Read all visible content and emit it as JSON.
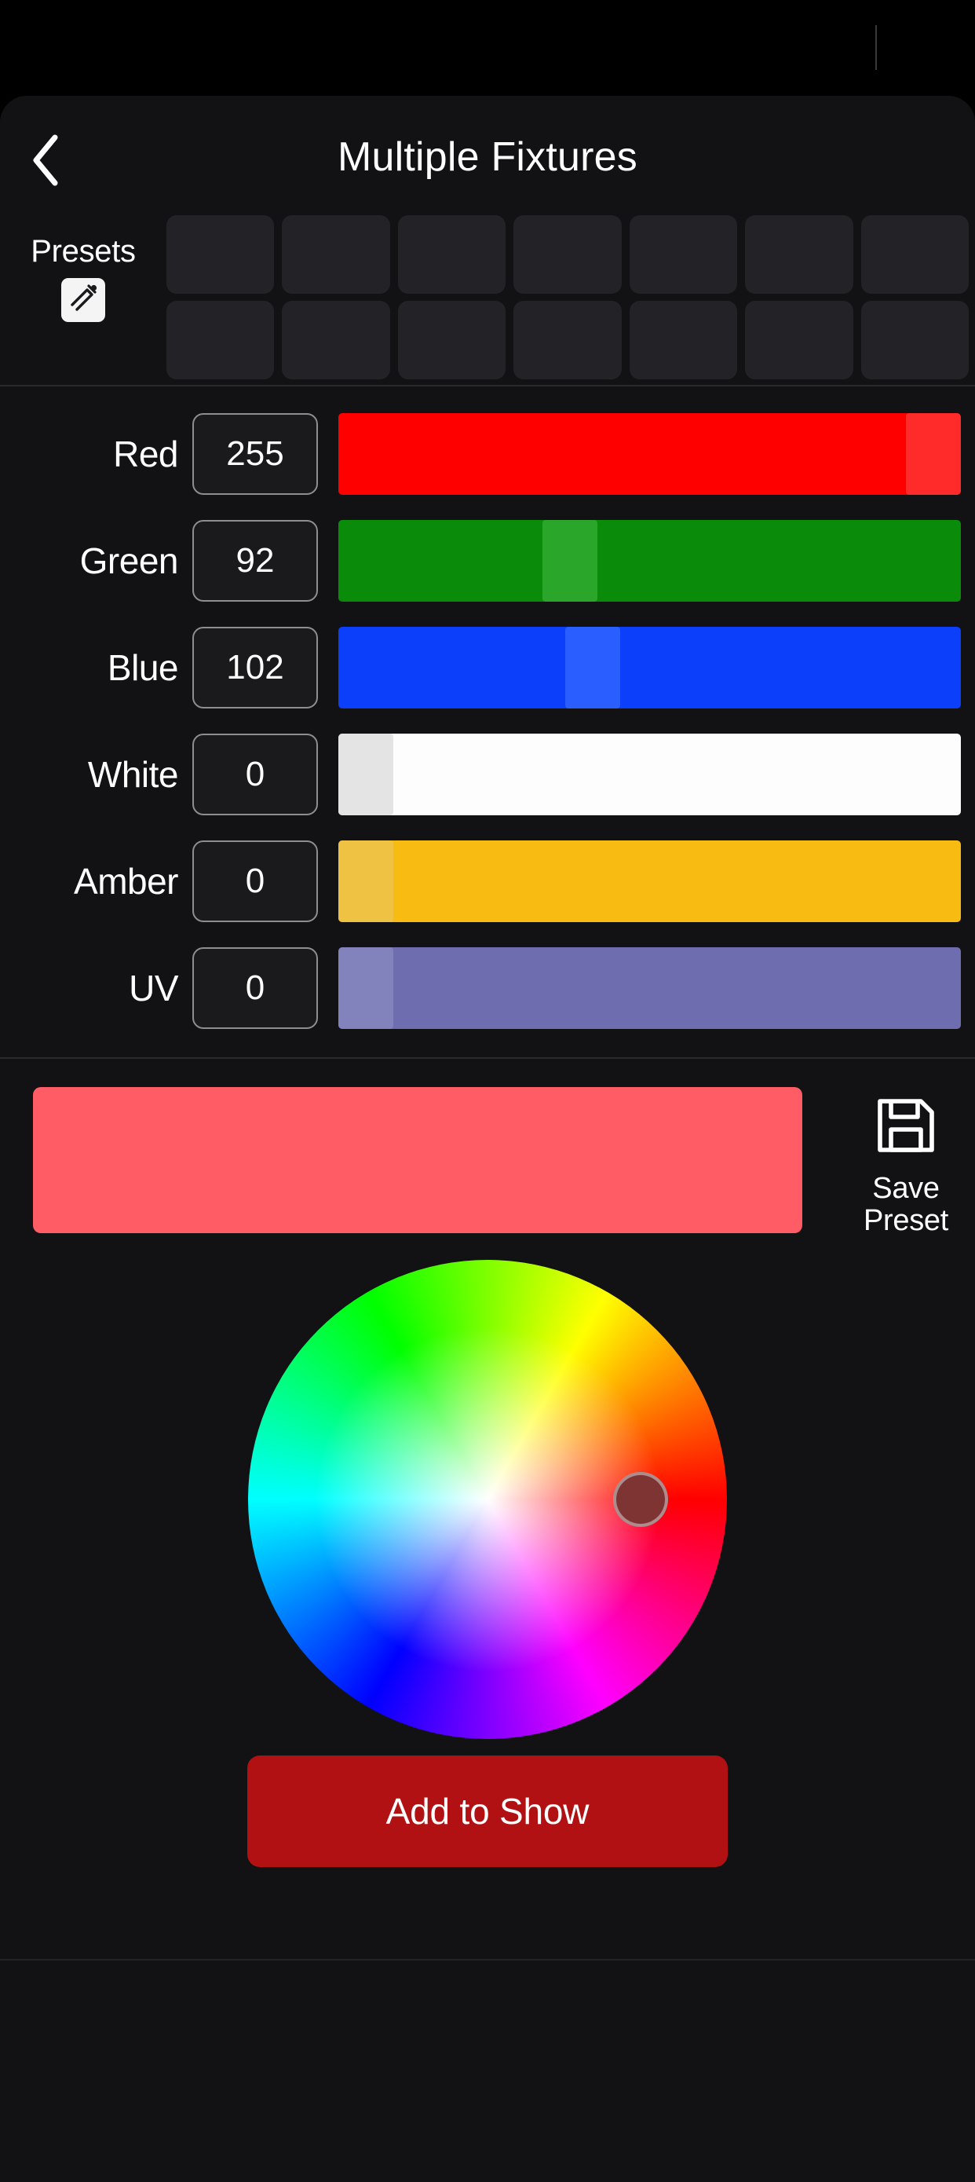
{
  "status_bar": {
    "caret_icon": "text-cursor"
  },
  "header": {
    "title": "Multiple Fixtures",
    "back_icon": "chevron-left-icon"
  },
  "presets": {
    "label": "Presets",
    "edit_icon": "edit-pencil-square-icon",
    "columns": 7,
    "rows": 2,
    "tiles": [
      {
        "label": ""
      },
      {
        "label": ""
      },
      {
        "label": ""
      },
      {
        "label": ""
      },
      {
        "label": ""
      },
      {
        "label": ""
      },
      {
        "label": ""
      },
      {
        "label": ""
      },
      {
        "label": ""
      },
      {
        "label": ""
      },
      {
        "label": ""
      },
      {
        "label": ""
      },
      {
        "label": ""
      },
      {
        "label": ""
      }
    ]
  },
  "channels": [
    {
      "name": "Red",
      "value": "255",
      "percent": 100,
      "track_color": "#fe0000",
      "thumb_color": "#ff2a2a"
    },
    {
      "name": "Green",
      "value": "92",
      "percent": 36,
      "track_color": "#0a8b0a",
      "thumb_color": "#2aa72a"
    },
    {
      "name": "Blue",
      "value": "102",
      "percent": 40,
      "track_color": "#0b3ff9",
      "thumb_color": "#2a5eff"
    },
    {
      "name": "White",
      "value": "0",
      "percent": 0,
      "track_color": "#fdfdfd",
      "thumb_color": "#e4e4e4"
    },
    {
      "name": "Amber",
      "value": "0",
      "percent": 0,
      "track_color": "#f8bb12",
      "thumb_color": "#efc244"
    },
    {
      "name": "UV",
      "value": "0",
      "percent": 0,
      "track_color": "#6d6daf",
      "thumb_color": "#8282bd"
    }
  ],
  "preview": {
    "color": "#ff5c66",
    "save_preset_icon": "floppy-disk-save-icon",
    "save_preset_label": "Save\nPreset",
    "save_preset_line1": "Save",
    "save_preset_line2": "Preset"
  },
  "color_wheel": {
    "selected_color": "#7e3432",
    "selector_x_percent": 82,
    "selector_y_percent": 50
  },
  "actions": {
    "add_to_show_label": "Add to Show",
    "add_to_show_color": "#b11112"
  }
}
